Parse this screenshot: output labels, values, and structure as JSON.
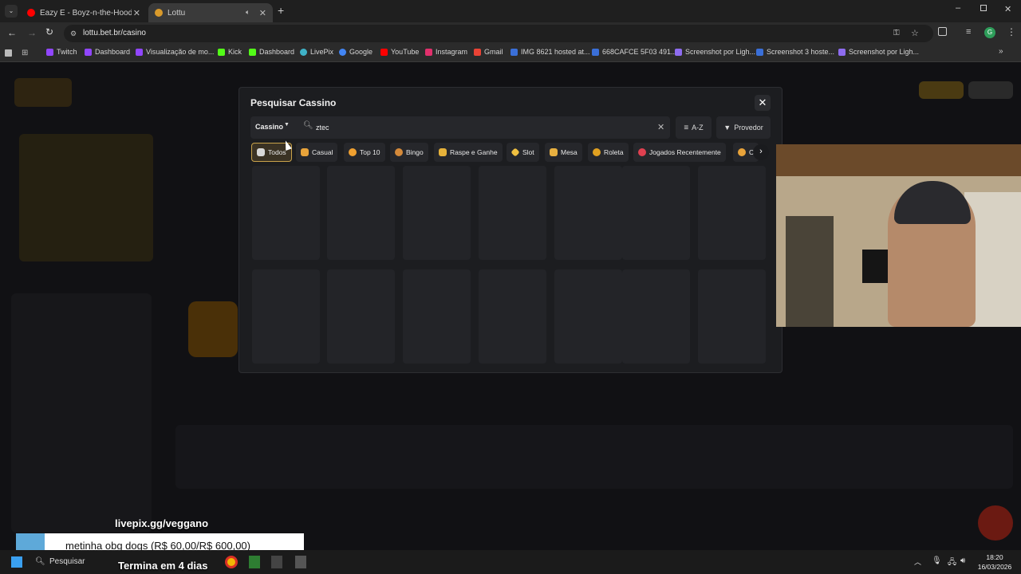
{
  "browser": {
    "tabs": [
      {
        "label": "Eazy E - Boyz-n-the-Hood (Mu",
        "icon": "youtube-icon",
        "active": false
      },
      {
        "label": "Lottu",
        "icon": "lottu-icon",
        "active": true
      }
    ],
    "new_tab": "+",
    "url": "lottu.bet.br/casino",
    "bookmarks": [
      {
        "label": "Twitch",
        "color": "#9146ff"
      },
      {
        "label": "Dashboard",
        "color": "#9146ff"
      },
      {
        "label": "Visualização de mo...",
        "color": "#9146ff"
      },
      {
        "label": "Kick",
        "color": "#53fc18"
      },
      {
        "label": "Dashboard",
        "color": "#53fc18"
      },
      {
        "label": "LivePix",
        "color": "#3fb2c7"
      },
      {
        "label": "Google",
        "color": "#4285f4"
      },
      {
        "label": "YouTube",
        "color": "#ff0000"
      },
      {
        "label": "Instagram",
        "color": "#e1306c"
      },
      {
        "label": "Gmail",
        "color": "#ea4335"
      },
      {
        "label": "IMG 8621 hosted at...",
        "color": "#3a6fd8"
      },
      {
        "label": "668CAFCE 5F03 491...",
        "color": "#3a6fd8"
      },
      {
        "label": "Screenshot por Ligh...",
        "color": "#8e6cf0"
      },
      {
        "label": "Screenshot 3 hoste...",
        "color": "#3a6fd8"
      },
      {
        "label": "Screenshot por Ligh...",
        "color": "#8e6cf0"
      }
    ]
  },
  "modal": {
    "title": "Pesquisar Cassino",
    "category_select": "Cassino",
    "search_value": "ztec",
    "sort_label": "A-Z",
    "provider_label": "Provedor",
    "chips": [
      {
        "label": "Todos",
        "active": true,
        "color": "#c8a24a"
      },
      {
        "label": "Casual",
        "active": false,
        "color": "#e8a33a"
      },
      {
        "label": "Top 10",
        "active": false,
        "color": "#f0a030"
      },
      {
        "label": "Bingo",
        "active": false,
        "color": "#d58a3a"
      },
      {
        "label": "Raspe e Ganhe",
        "active": false,
        "color": "#e6b23a"
      },
      {
        "label": "Slot",
        "active": false,
        "color": "#f0c040"
      },
      {
        "label": "Mesa",
        "active": false,
        "color": "#e8b040"
      },
      {
        "label": "Roleta",
        "active": false,
        "color": "#e0a020"
      },
      {
        "label": "Jogados Recentemente",
        "active": false,
        "color": "#e04050"
      },
      {
        "label": "C",
        "active": false,
        "color": "#e8a33a"
      }
    ]
  },
  "overlay": {
    "livepix_handle": "livepix.gg/veggano",
    "donation_message": "metinha obg dogs (R$ 60,00/R$ 600,00)",
    "countdown": "Termina em 4 dias"
  },
  "taskbar": {
    "search_placeholder": "Pesquisar",
    "time": "18:20",
    "date": "16/03/2026"
  }
}
